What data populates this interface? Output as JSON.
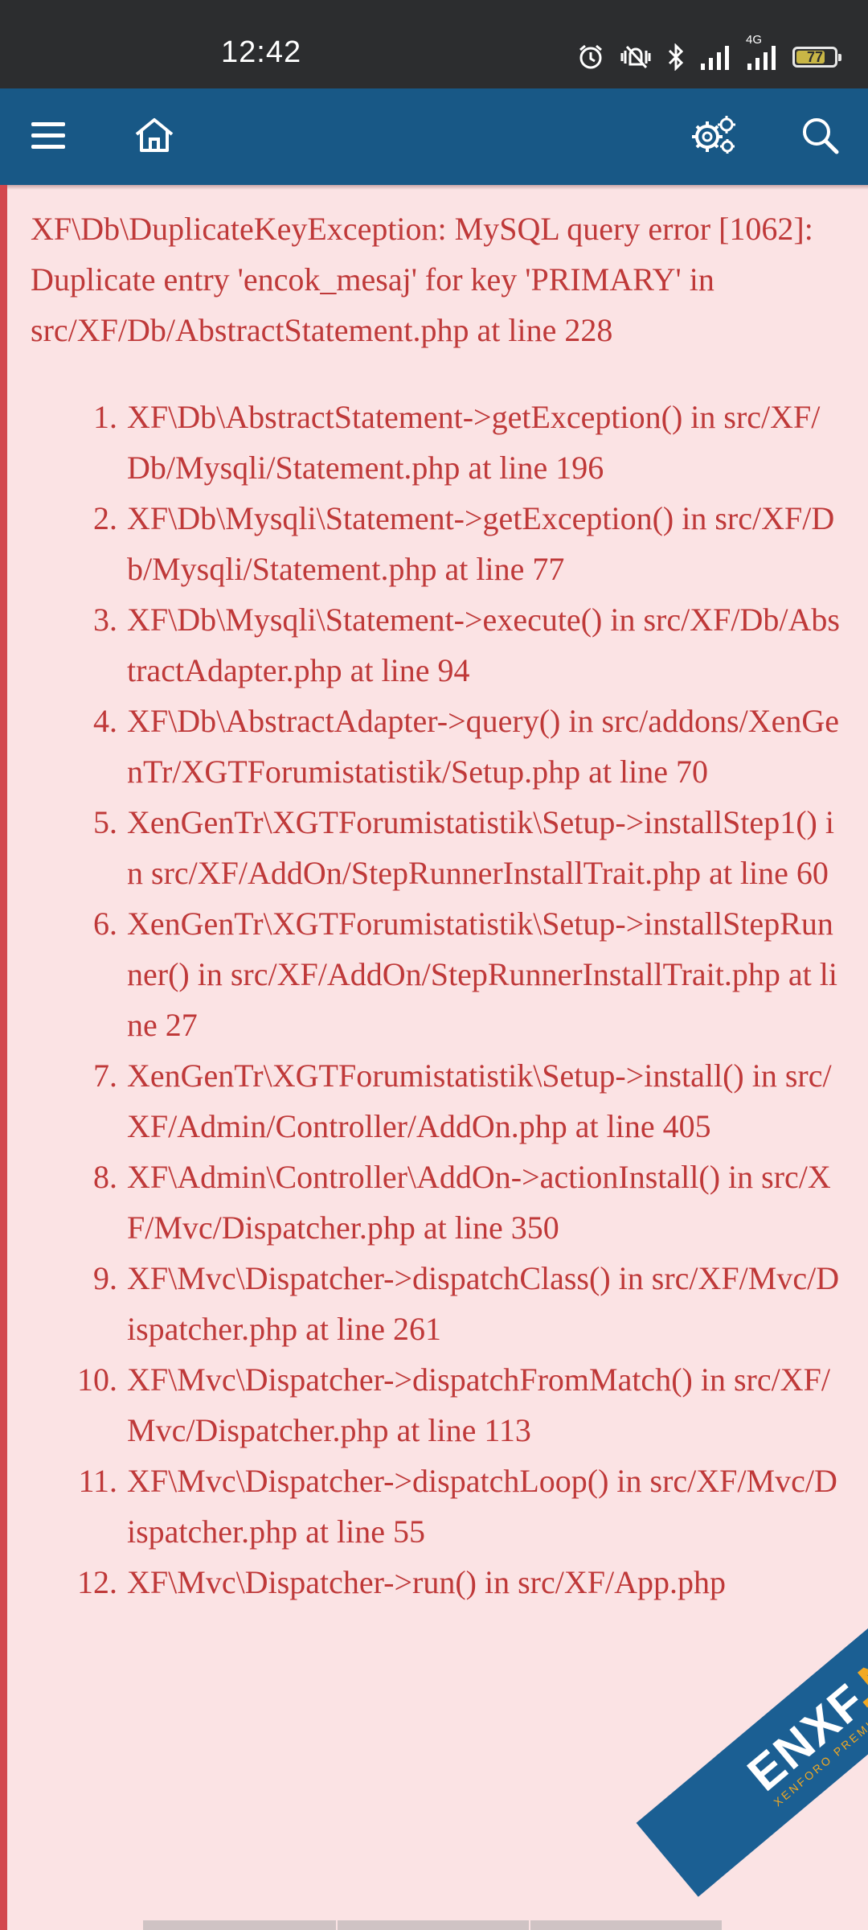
{
  "status_bar": {
    "time": "12:42",
    "network": "4G",
    "battery": "77",
    "battery_level": 0.77
  },
  "app_bar": {
    "icons": [
      "menu-icon",
      "home-icon",
      "settings-icon",
      "search-icon"
    ]
  },
  "error": {
    "title": "XF\\Db\\DuplicateKeyException: MySQL query error [1062]: Duplicate entry 'encok_mesaj' for key 'PRIMARY' in src/XF/Db/AbstractStatement.php at line 228",
    "trace": [
      {
        "num": "1.",
        "text": "XF\\Db\\AbstractStatement->getException() in src/XF/Db/Mysqli/Statement.php at line 196"
      },
      {
        "num": "2.",
        "text": "XF\\Db\\Mysqli\\Statement->getException() in src/XF/Db/Mysqli/Statement.php at line 77"
      },
      {
        "num": "3.",
        "text": "XF\\Db\\Mysqli\\Statement->execute() in src/XF/Db/AbstractAdapter.php at line 94"
      },
      {
        "num": "4.",
        "text": "XF\\Db\\AbstractAdapter->query() in src/addons/XenGenTr/XGTForumistatistik/Setup.php at line 70"
      },
      {
        "num": "5.",
        "text": "XenGenTr\\XGTForumistatistik\\Setup->installStep1() in src/XF/AddOn/StepRunnerInstallTrait.php at line 60"
      },
      {
        "num": "6.",
        "text": "XenGenTr\\XGTForumistatistik\\Setup->installStepRunner() in src/XF/AddOn/StepRunnerInstallTrait.php at line 27"
      },
      {
        "num": "7.",
        "text": "XenGenTr\\XGTForumistatistik\\Setup->install() in src/XF/Admin/Controller/AddOn.php at line 405"
      },
      {
        "num": "8.",
        "text": "XF\\Admin\\Controller\\AddOn->actionInstall() in src/XF/Mvc/Dispatcher.php at line 350"
      },
      {
        "num": "9.",
        "text": "XF\\Mvc\\Dispatcher->dispatchClass() in src/XF/Mvc/Dispatcher.php at line 261"
      },
      {
        "num": "10.",
        "text": "XF\\Mvc\\Dispatcher->dispatchFromMatch() in src/XF/Mvc/Dispatcher.php at line 113"
      },
      {
        "num": "11.",
        "text": "XF\\Mvc\\Dispatcher->dispatchLoop() in src/XF/Mvc/Dispatcher.php at line 55"
      },
      {
        "num": "12.",
        "text": "XF\\Mvc\\Dispatcher->run() in src/XF/App.php"
      }
    ]
  },
  "watermark": {
    "main": "ENXF",
    "tld": ".NET",
    "sub": "XENFORO PREMIUM COMMUNITY"
  }
}
